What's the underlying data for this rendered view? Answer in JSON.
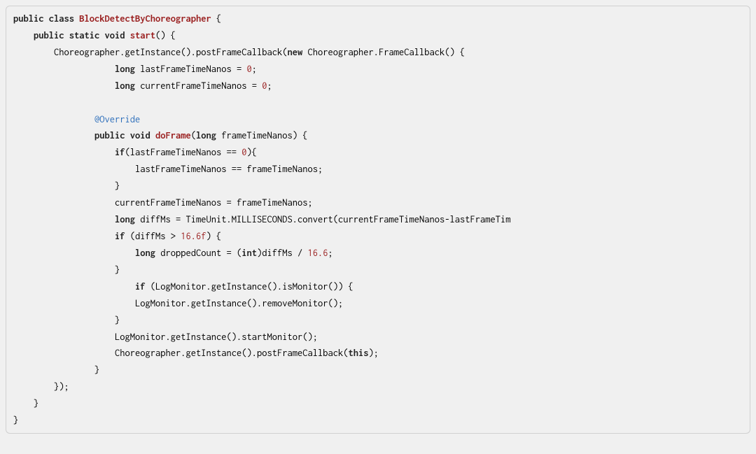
{
  "code": {
    "l1": {
      "kw1": "public",
      "kw2": "class",
      "cls": "BlockDetectByChoreographer",
      "tail": " {"
    },
    "l2": {
      "indent": "    ",
      "kw1": "public",
      "kw2": "static",
      "kw3": "void",
      "method": "start",
      "tail": "() {"
    },
    "l3": {
      "indent": "        ",
      "pre": "Choreographer.getInstance().postFrameCallback(",
      "kw": "new",
      "post": " Choreographer.FrameCallback() {"
    },
    "l4": {
      "indent": "                    ",
      "kw": "long",
      "rest": " lastFrameTimeNanos = ",
      "num": "0",
      "tail": ";"
    },
    "l5": {
      "indent": "                    ",
      "kw": "long",
      "rest": " currentFrameTimeNanos = ",
      "num": "0",
      "tail": ";"
    },
    "l6": "",
    "l7": {
      "indent": "                ",
      "anno": "@Override"
    },
    "l8": {
      "indent": "                ",
      "kw1": "public",
      "kw2": "void",
      "method": "doFrame",
      "paren": "(",
      "kw3": "long",
      "param": " frameTimeNanos) {"
    },
    "l9": {
      "indent": "                    ",
      "kw": "if",
      "pre": "(lastFrameTimeNanos == ",
      "num": "0",
      "tail": "){"
    },
    "l10": {
      "indent": "                        ",
      "text": "lastFrameTimeNanos == frameTimeNanos;"
    },
    "l11": {
      "indent": "                    ",
      "text": "}"
    },
    "l12": {
      "indent": "                    ",
      "text": "currentFrameTimeNanos = frameTimeNanos;"
    },
    "l13": {
      "indent": "                    ",
      "kw": "long",
      "text": " diffMs = TimeUnit.MILLISECONDS.convert(currentFrameTimeNanos-lastFrameTim"
    },
    "l14": {
      "indent": "                    ",
      "kw": "if",
      "pre": " (diffMs > ",
      "num": "16.6f",
      "tail": ") {"
    },
    "l15": {
      "indent": "                        ",
      "kw1": "long",
      "mid1": " droppedCount = (",
      "kw2": "int",
      "mid2": ")diffMs / ",
      "num": "16.6",
      "tail": ";"
    },
    "l16": {
      "indent": "                    ",
      "text": "}"
    },
    "l17": {
      "indent": "                        ",
      "kw": "if",
      "tail": " (LogMonitor.getInstance().isMonitor()) {"
    },
    "l18": {
      "indent": "                        ",
      "text": "LogMonitor.getInstance().removeMonitor();"
    },
    "l19": {
      "indent": "                    ",
      "text": "}"
    },
    "l20": {
      "indent": "                    ",
      "text": "LogMonitor.getInstance().startMonitor();"
    },
    "l21": {
      "indent": "                    ",
      "pre": "Choreographer.getInstance().postFrameCallback(",
      "kw": "this",
      "tail": ");"
    },
    "l22": {
      "indent": "                ",
      "text": "}"
    },
    "l23": {
      "indent": "        ",
      "text": "});"
    },
    "l24": {
      "indent": "    ",
      "text": "}"
    },
    "l25": {
      "text": "}"
    }
  }
}
